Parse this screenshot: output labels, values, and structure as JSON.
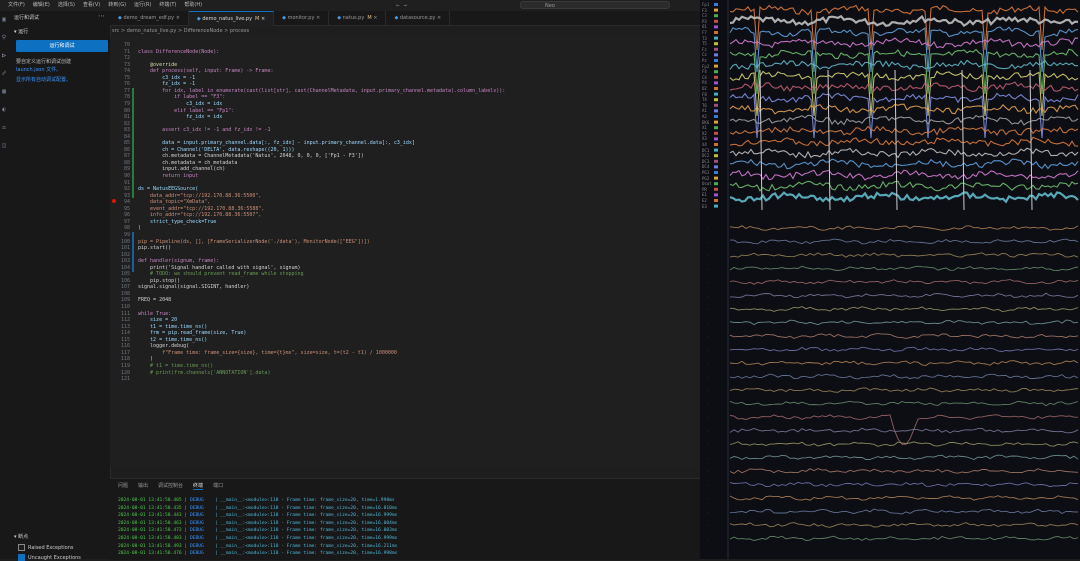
{
  "menu": [
    "文件(F)",
    "编辑(E)",
    "选择(S)",
    "查看(V)",
    "转到(G)",
    "运行(R)",
    "终端(T)",
    "帮助(H)"
  ],
  "command_center": "Neo",
  "sidebar": {
    "title": "运行和调试",
    "section": "运行",
    "run_button": "运行和调试",
    "info_text": "要自定义运行和调试创建",
    "info_link": "launch.json 文件。",
    "show_link": "显示所有自动调试配置。",
    "breakpoints_title": "断点",
    "breakpoints": [
      {
        "label": "Raised Exceptions",
        "checked": false
      },
      {
        "label": "Uncaught Exceptions",
        "checked": true
      }
    ]
  },
  "tabs": [
    {
      "label": "demo_dream_edf.py",
      "active": false,
      "modified": ""
    },
    {
      "label": "demo_natus_live.py",
      "active": true,
      "modified": "M"
    },
    {
      "label": "monitor.py",
      "active": false,
      "modified": ""
    },
    {
      "label": "natus.py",
      "active": false,
      "modified": "M"
    },
    {
      "label": "datasource.py",
      "active": false,
      "modified": ""
    }
  ],
  "breadcrumb": "src > demo_natus_live.py > DifferenceNode > process",
  "code_lines": [
    {
      "n": "70",
      "t": ""
    },
    {
      "n": "71",
      "t": "class DifferenceNode(Node):"
    },
    {
      "n": "72",
      "t": ""
    },
    {
      "n": "73",
      "t": "    @override"
    },
    {
      "n": "74",
      "t": "    def process(self, input: Frame) -> Frame:"
    },
    {
      "n": "75",
      "t": "        c3_idx = -1"
    },
    {
      "n": "76",
      "t": "        fz_idx = -1"
    },
    {
      "n": "77",
      "t": "        for idx, label in enumerate(cast(list[str], cast(ChannelMetadata, input.primary_channel.metadata).column_labels)):"
    },
    {
      "n": "78",
      "t": "            if label == \"F3\":"
    },
    {
      "n": "79",
      "t": "                c3_idx = idx"
    },
    {
      "n": "80",
      "t": "            elif label == \"Fp1\":"
    },
    {
      "n": "81",
      "t": "                fz_idx = idx"
    },
    {
      "n": "82",
      "t": ""
    },
    {
      "n": "83",
      "t": "        assert c3_idx != -1 and fz_idx != -1"
    },
    {
      "n": "84",
      "t": ""
    },
    {
      "n": "85",
      "t": "        data = input.primary_channel.data[:, fz_idx] - input.primary_channel.data[:, c3_idx]"
    },
    {
      "n": "86",
      "t": "        ch = Channel('DELTA', data.reshape((20, 1)))"
    },
    {
      "n": "87",
      "t": "        ch.metadata = ChannelMetadata('Natus', 2048, 0, 0, 0, ['Fp1 - F3'])"
    },
    {
      "n": "88",
      "t": "        ch.metadata = ch_metadata"
    },
    {
      "n": "89",
      "t": "        input.add_channel(ch)"
    },
    {
      "n": "90",
      "t": "        return input"
    },
    {
      "n": "91",
      "t": ""
    },
    {
      "n": "92",
      "t": "ds = NatusEEGSource("
    },
    {
      "n": "93",
      "t": "    data_addr=\"tcp://192.170.88.36:5500\","
    },
    {
      "n": "94",
      "t": "    data_topic=\"XmData\","
    },
    {
      "n": "95",
      "t": "    event_addr=\"tcp://192.170.88.36:5588\","
    },
    {
      "n": "96",
      "t": "    info_addr=\"tcp://192.170.88.36:5507\","
    },
    {
      "n": "97",
      "t": "    strict_type_check=True"
    },
    {
      "n": "98",
      "t": ")"
    },
    {
      "n": "99",
      "t": ""
    },
    {
      "n": "100",
      "t": "pip = Pipeline(ds, [], [FrameSerializerNode('./data'), MonitorNode([\"EEG\"])])"
    },
    {
      "n": "101",
      "t": "pip.start()"
    },
    {
      "n": "102",
      "t": ""
    },
    {
      "n": "103",
      "t": "def handler(signum, frame):"
    },
    {
      "n": "104",
      "t": "    print('Signal handler called with signal', signum)"
    },
    {
      "n": "105",
      "t": "    # TODO: we should prevent read_frame while stopping"
    },
    {
      "n": "106",
      "t": "    pip.stop()"
    },
    {
      "n": "107",
      "t": "signal.signal(signal.SIGINT, handler)"
    },
    {
      "n": "108",
      "t": ""
    },
    {
      "n": "109",
      "t": "FREQ = 2048"
    },
    {
      "n": "110",
      "t": ""
    },
    {
      "n": "111",
      "t": "while True:"
    },
    {
      "n": "112",
      "t": "    size = 20"
    },
    {
      "n": "113",
      "t": "    t1 = time.time_ns()"
    },
    {
      "n": "114",
      "t": "    frm = pip.read_frame(size, True)"
    },
    {
      "n": "115",
      "t": "    t2 = time.time_ns()"
    },
    {
      "n": "116",
      "t": "    logger.debug("
    },
    {
      "n": "117",
      "t": "        f\"Frame time: frame_size={size}, time={t}ms\", size=size, t=(t2 - t1) / 1000000"
    },
    {
      "n": "118",
      "t": "    )"
    },
    {
      "n": "119",
      "t": "    # t1 = time.time_ns()"
    },
    {
      "n": "120",
      "t": "    # print(frm.channels['ANNOTATION'].data)"
    },
    {
      "n": "121",
      "t": ""
    }
  ],
  "panel_tabs": [
    "问题",
    "输出",
    "调试控制台",
    "终端",
    "端口"
  ],
  "terminal_lines": [
    {
      "ts": "2024-08-01 13:41:58.405",
      "lvl": "DEBUG",
      "msg": "| __main__:<module>:118 - Frame time: frame_size=20, time=1.998ms"
    },
    {
      "ts": "2024-08-01 13:41:58.435",
      "lvl": "DEBUG",
      "msg": "| __main__:<module>:118 - Frame time: frame_size=20, time=16.010ms"
    },
    {
      "ts": "2024-08-01 13:41:58.443",
      "lvl": "DEBUG",
      "msg": "| __main__:<module>:118 - Frame time: frame_size=20, time=16.999ms"
    },
    {
      "ts": "2024-08-01 13:41:58.463",
      "lvl": "DEBUG",
      "msg": "| __main__:<module>:118 - Frame time: frame_size=20, time=16.004ms"
    },
    {
      "ts": "2024-08-01 13:41:58.473",
      "lvl": "DEBUG",
      "msg": "| __main__:<module>:118 - Frame time: frame_size=20, time=16.003ms"
    },
    {
      "ts": "2024-08-01 13:41:58.483",
      "lvl": "DEBUG",
      "msg": "| __main__:<module>:118 - Frame time: frame_size=20, time=16.999ms"
    },
    {
      "ts": "2024-08-01 13:41:58.493",
      "lvl": "DEBUG",
      "msg": "| __main__:<module>:118 - Frame time: frame_size=20, time=16.211ms"
    },
    {
      "ts": "2024-08-01 13:41:58.476",
      "lvl": "DEBUG",
      "msg": "| __main__:<module>:118 - Frame time: frame_size=20, time=16.998ms"
    }
  ],
  "monitor": {
    "channels_top": [
      "Fp1",
      "F3",
      "C3",
      "P3",
      "O1",
      "F7",
      "T3",
      "T5",
      "Fz",
      "Cz",
      "Pz",
      "Fp2",
      "F4",
      "C4",
      "P4",
      "O2",
      "F8",
      "T4",
      "T6",
      "A1",
      "A2",
      "EKG",
      "X1",
      "X2",
      "X3",
      "X4",
      "DC1",
      "DC2",
      "DC3",
      "DC4",
      "PG1",
      "PG2",
      "Osat",
      "PR",
      "E1",
      "E2",
      "E3"
    ],
    "colors": [
      "#3b7bd0",
      "#e0a040",
      "#4caf50",
      "#c05050",
      "#9b59d0",
      "#d07030",
      "#40b0c0",
      "#c0c040",
      "#a05080",
      "#7080e0"
    ]
  }
}
